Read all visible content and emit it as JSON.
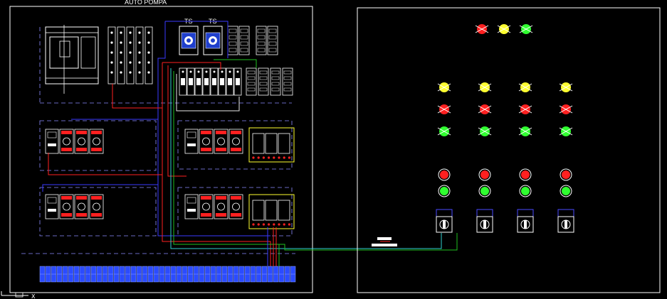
{
  "drawing": {
    "left_panel_title": "AUTO POMPA",
    "relay_labels": [
      "TS",
      "TS"
    ],
    "ucs_x_label": "X",
    "ucs_y_label": "Y"
  },
  "colors": {
    "background": "#000000",
    "frame": "#ffffff",
    "wire_red": "#ff2020",
    "wire_blue": "#3a3aff",
    "wire_green": "#20c020",
    "wire_cyan": "#30d0d0",
    "wire_white": "#e8e8e8",
    "lamp_yellow": "#ffff30",
    "lamp_red": "#ff2020",
    "lamp_green": "#30ff30",
    "terminal_blue": "#2b4bff",
    "relay_face": "#1f3fcc"
  },
  "front_panel": {
    "top_indicator_colors": [
      "red",
      "yellow",
      "green"
    ],
    "pump_columns": 4,
    "lamp_row_colors": [
      "yellow",
      "red",
      "green"
    ],
    "button_row_colors": [
      "red",
      "green"
    ],
    "selector_switch_icon": "rotary-selector-icon"
  }
}
